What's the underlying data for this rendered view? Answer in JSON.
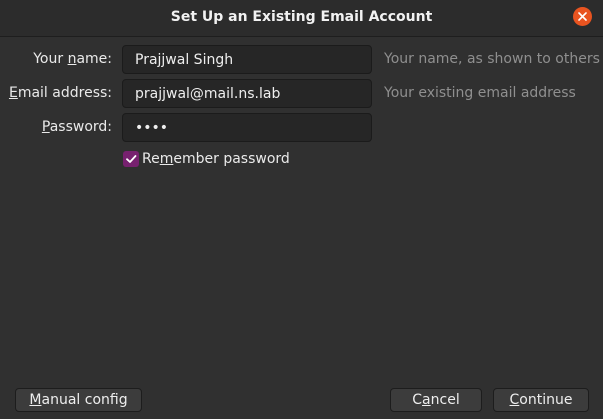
{
  "window": {
    "title": "Set Up an Existing Email Account",
    "close_icon": "close-icon"
  },
  "form": {
    "name": {
      "label_pre": "Your ",
      "label_ul": "n",
      "label_post": "ame:",
      "value": "Prajjwal Singh",
      "hint": "Your name, as shown to others"
    },
    "email": {
      "label_ul": "E",
      "label_post": "mail address:",
      "value": "prajjwal@mail.ns.lab",
      "hint": "Your existing email address"
    },
    "password": {
      "label_ul": "P",
      "label_post": "assword:",
      "value": "••••"
    },
    "remember": {
      "label_pre": "Re",
      "label_ul": "m",
      "label_post": "ember password",
      "checked": true
    }
  },
  "buttons": {
    "manual": {
      "ul": "M",
      "rest": "anual config"
    },
    "cancel": {
      "pre": "C",
      "ul": "a",
      "rest": "ncel"
    },
    "continue": {
      "ul": "C",
      "rest": "ontinue"
    }
  },
  "colors": {
    "accent_close": "#e95420",
    "checkbox": "#77216f",
    "background": "#303030"
  }
}
